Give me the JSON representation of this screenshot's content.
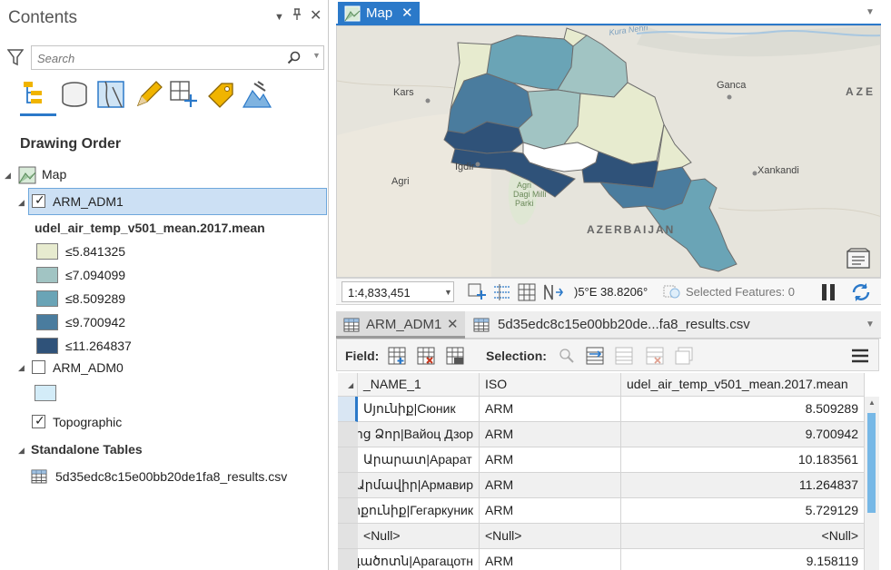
{
  "contents": {
    "title": "Contents",
    "search_placeholder": "Search",
    "drawing_order": "Drawing Order",
    "map_item": "Map",
    "layer_arm1": "ARM_ADM1",
    "legend_field": "udel_air_temp_v501_mean.2017.mean",
    "legend": [
      {
        "label": "≤5.841325",
        "color": "#e7ebcf"
      },
      {
        "label": "≤7.094099",
        "color": "#a1c4c3"
      },
      {
        "label": "≤8.509289",
        "color": "#6aa4b6"
      },
      {
        "label": "≤9.700942",
        "color": "#4a7c9e"
      },
      {
        "label": "≤11.264837",
        "color": "#2f5279"
      }
    ],
    "layer_arm0": "ARM_ADM0",
    "arm0_color": "#d3ecf8",
    "topographic": "Topographic",
    "standalone_tables": "Standalone Tables",
    "csv_table": "5d35edc8c15e00bb20de1fa8_results.csv"
  },
  "map": {
    "tab_label": "Map",
    "labels": {
      "kura": "Kura Nehri",
      "ganca": "Ganca",
      "aze": "AZE",
      "kars": "Kars",
      "igdir": "Igdir",
      "agri": "Agri",
      "agri_dagi_1": "Agri",
      "agri_dagi_2": "Dagi Milli",
      "agri_dagi_3": "Parki",
      "xankandi": "Xankandi",
      "azerbaijan": "AZERBAIJAN"
    },
    "scale": "1:4,833,451",
    "coords": ")5°E 38.8206°",
    "selected_features": "Selected Features: 0"
  },
  "tables": {
    "tab1": "ARM_ADM1",
    "tab2": "5d35edc8c15e00bb20de...fa8_results.csv",
    "field_label": "Field:",
    "selection_label": "Selection:",
    "headers": [
      "_NAME_1",
      "ISO",
      "udel_air_temp_v501_mean.2017.mean"
    ],
    "rows": [
      {
        "name": "Սյունիք|Сюник",
        "iso": "ARM",
        "value": "8.509289"
      },
      {
        "name": "Վայոց Ձոր|Вайоц Дзор",
        "iso": "ARM",
        "value": "9.700942"
      },
      {
        "name": "Արարատ|Арарат",
        "iso": "ARM",
        "value": "10.183561"
      },
      {
        "name": "Արմավիր|Армавир",
        "iso": "ARM",
        "value": "11.264837"
      },
      {
        "name": "Գեղարքունիք|Гегаркуник",
        "iso": "ARM",
        "value": "5.729129"
      },
      {
        "name": "<Null>",
        "iso": "<Null>",
        "value": "<Null>"
      },
      {
        "name": "Արագածոտն|Арагацотн",
        "iso": "ARM",
        "value": "9.158119"
      }
    ]
  }
}
